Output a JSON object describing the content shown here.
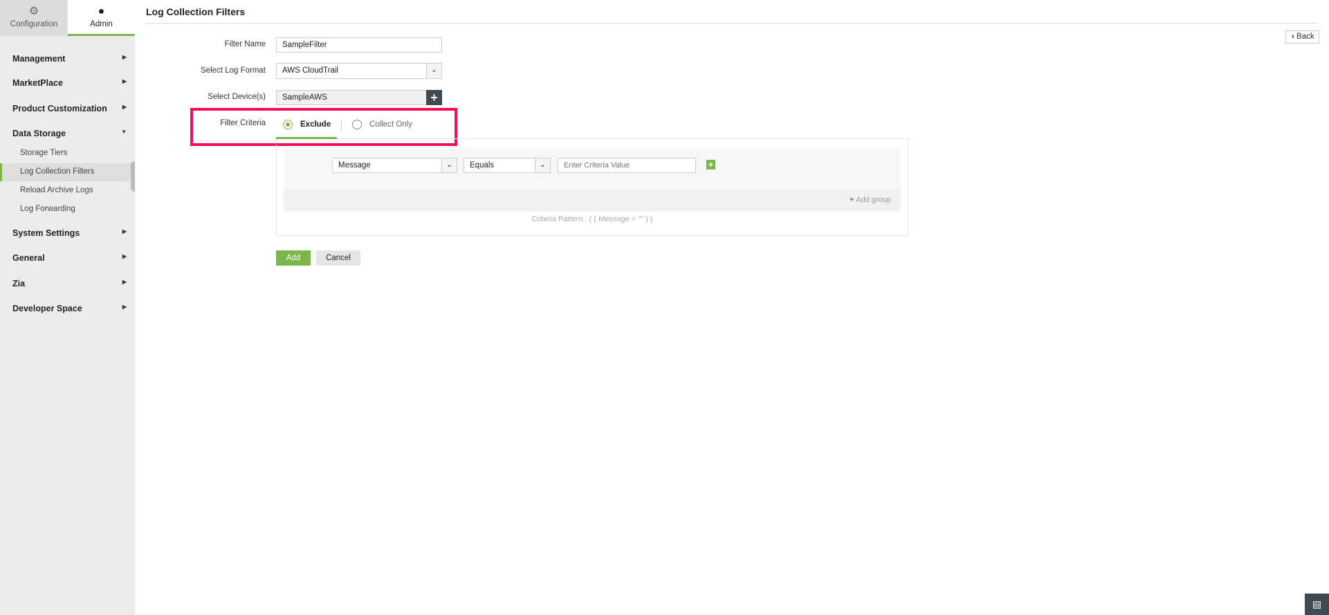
{
  "sidebar": {
    "tabs": [
      {
        "label": "Configuration",
        "icon": "gear-icon"
      },
      {
        "label": "Admin",
        "icon": "user-icon"
      }
    ],
    "sections": [
      {
        "label": "Management"
      },
      {
        "label": "MarketPlace"
      },
      {
        "label": "Product Customization"
      },
      {
        "label": "Data Storage"
      },
      {
        "label": "System Settings"
      },
      {
        "label": "General"
      },
      {
        "label": "Zia"
      },
      {
        "label": "Developer Space"
      }
    ],
    "data_storage_items": [
      {
        "label": "Storage Tiers"
      },
      {
        "label": "Log Collection Filters"
      },
      {
        "label": "Reload Archive Logs"
      },
      {
        "label": "Log Forwarding"
      }
    ]
  },
  "header": {
    "title": "Log Collection Filters",
    "back_label": "Back"
  },
  "form": {
    "filter_name_label": "Filter Name",
    "filter_name_value": "SampleFilter",
    "log_format_label": "Select Log Format",
    "log_format_value": "AWS CloudTrail",
    "devices_label": "Select Device(s)",
    "devices_value": "SampleAWS",
    "criteria_label": "Filter Criteria",
    "criteria_options": [
      {
        "label": "Exclude",
        "selected": true
      },
      {
        "label": "Collect Only",
        "selected": false
      }
    ],
    "criteria_field": "Message",
    "criteria_operator": "Equals",
    "criteria_value_placeholder": "Enter Criteria Value",
    "add_group_label": "Add group",
    "criteria_pattern": "Criteria Pattern : ( ( Message = \"\" ) )",
    "add_label": "Add",
    "cancel_label": "Cancel"
  },
  "colors": {
    "accent": "#7ab648",
    "highlight": "#ff0a54",
    "dark": "#3f4a52"
  }
}
